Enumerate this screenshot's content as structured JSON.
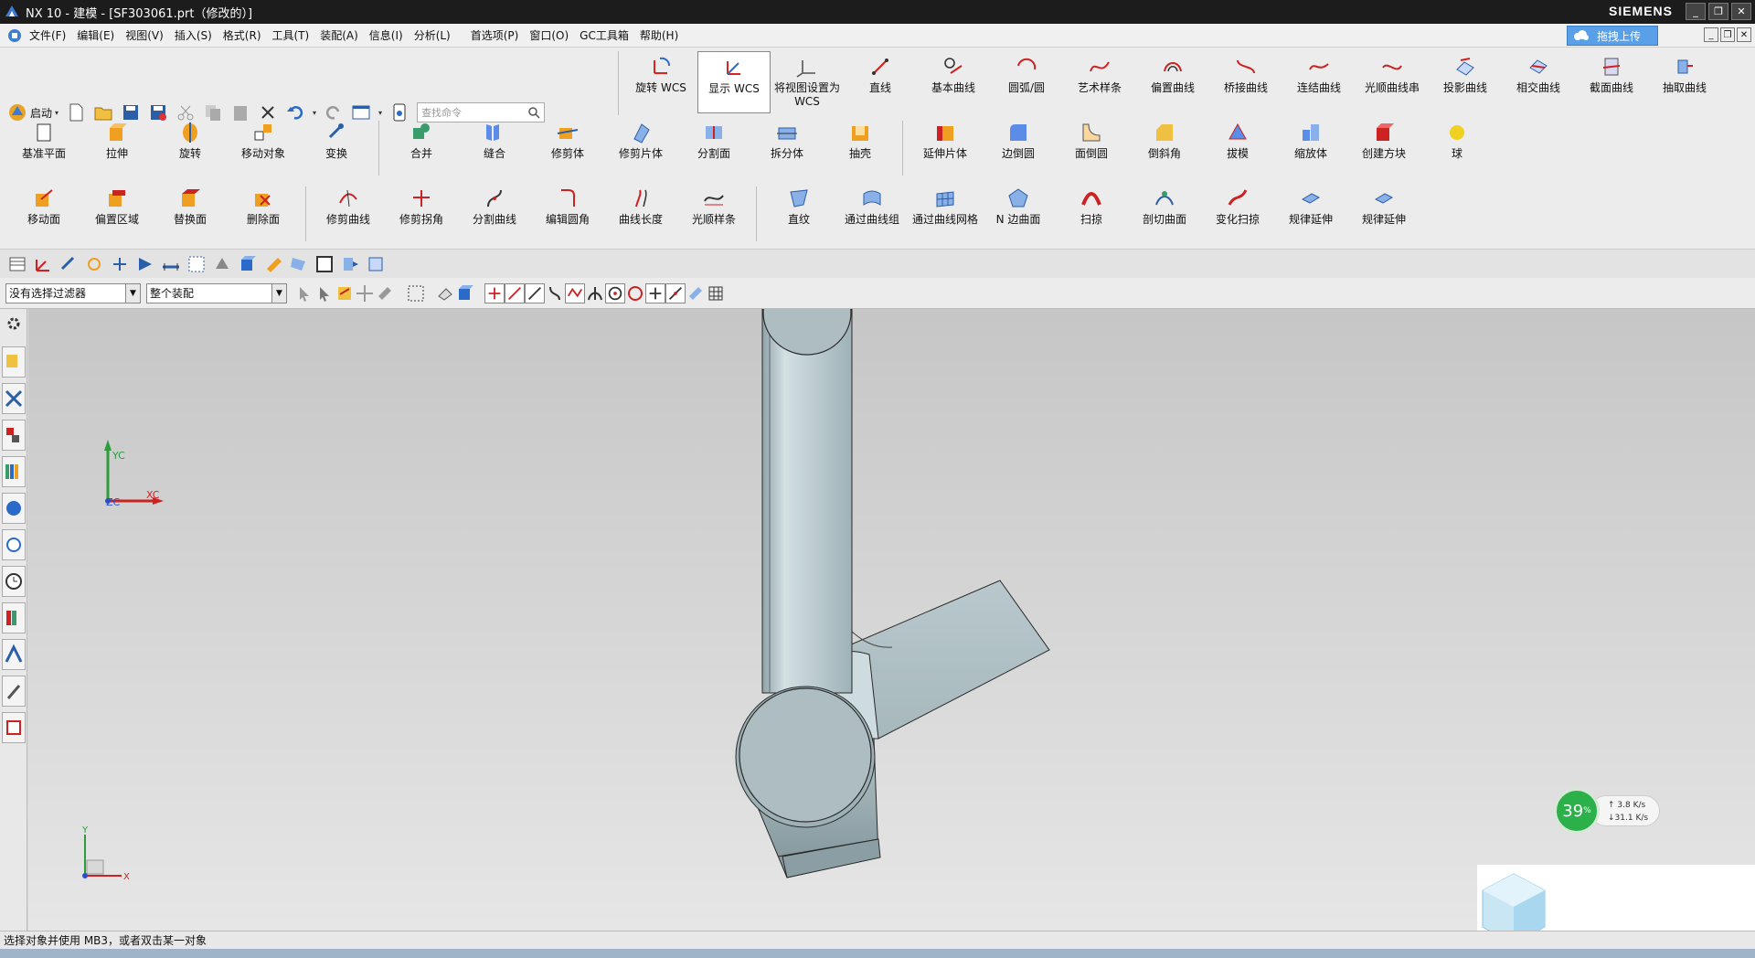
{
  "window": {
    "title": "NX 10 - 建模 - [SF303061.prt（修改的）]",
    "brand": "SIEMENS",
    "upload_button": "拖拽上传"
  },
  "menu": [
    "文件(F)",
    "编辑(E)",
    "视图(V)",
    "插入(S)",
    "格式(R)",
    "工具(T)",
    "装配(A)",
    "信息(I)",
    "分析(L)",
    "首选项(P)",
    "窗口(O)",
    "GC工具箱",
    "帮助(H)"
  ],
  "quick_access": {
    "start_label": "启动",
    "search_placeholder": "查找命令"
  },
  "ribbon_row1": [
    "旋转 WCS",
    "显示 WCS",
    "将视图设置为 WCS",
    "直线",
    "基本曲线",
    "圆弧/圆",
    "艺术样条",
    "偏置曲线",
    "桥接曲线",
    "连结曲线",
    "光顺曲线串",
    "投影曲线",
    "相交曲线",
    "截面曲线",
    "抽取曲线"
  ],
  "ribbon_row2": [
    "基准平面",
    "拉伸",
    "旋转",
    "移动对象",
    "变换",
    "合并",
    "缝合",
    "修剪体",
    "修剪片体",
    "分割面",
    "拆分体",
    "抽壳",
    "延伸片体",
    "边倒圆",
    "面倒圆",
    "倒斜角",
    "拔模",
    "缩放体",
    "创建方块",
    "球"
  ],
  "ribbon_row3": [
    "移动面",
    "偏置区域",
    "替换面",
    "删除面",
    "修剪曲线",
    "修剪拐角",
    "分割曲线",
    "编辑圆角",
    "曲线长度",
    "光顺样条",
    "直纹",
    "通过曲线组",
    "通过曲线网格",
    "N 边曲面",
    "扫掠",
    "剖切曲面",
    "变化扫掠",
    "规律延伸",
    "规律延伸"
  ],
  "filter": {
    "type_filter": "没有选择过滤器",
    "scope_filter": "整个装配"
  },
  "wcs": {
    "x_label": "XC",
    "y_label": "YC",
    "z_label": "ZC"
  },
  "triad": {
    "x_label": "X",
    "y_label": "Y"
  },
  "status": {
    "message": "选择对象并使用 MB3，或者双击某一对象"
  },
  "net_widget": {
    "percent": "39",
    "percent_sign": "%",
    "upload": "3.8 K/s",
    "download": "31.1 K/s"
  },
  "colors": {
    "title_bg": "#1c1c1c",
    "viewport_top": "#c6c6c6",
    "viewport_bottom": "#e6e6e6",
    "part_fill": "#b8c8cc",
    "net_green": "#2bb04a"
  }
}
